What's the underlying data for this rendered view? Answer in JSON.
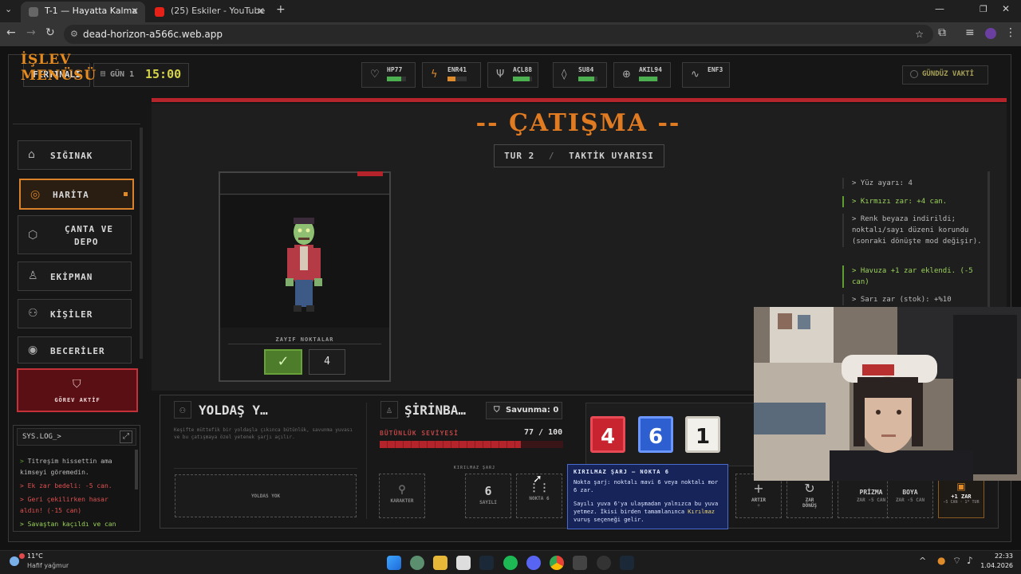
{
  "browser": {
    "tabs": [
      {
        "title": "T-1 — Hayatta Kalma"
      },
      {
        "title": "(25) Eskiler - YouTube"
      }
    ],
    "url": "dead-horizon-a566c.web.app"
  },
  "topbar": {
    "weather": "FIRTINALI",
    "day_label": "GÜN 1",
    "time": "15:00",
    "daytime": "GÜNDÜZ VAKTİ",
    "stats": [
      {
        "label": "HP77",
        "value": 77,
        "color": "#4caf50",
        "icon": "heart-icon"
      },
      {
        "label": "ENR41",
        "value": 41,
        "color": "#e08b2a",
        "icon": "bolt-icon"
      },
      {
        "label": "AÇL88",
        "value": 88,
        "color": "#4caf50",
        "icon": "fork-icon"
      },
      {
        "label": "SU84",
        "value": 84,
        "color": "#4caf50",
        "icon": "drop-icon"
      },
      {
        "label": "AKIL94",
        "value": 94,
        "color": "#4caf50",
        "icon": "brain-icon"
      },
      {
        "label": "ENF3",
        "value": 3,
        "color": "#4caf50",
        "icon": "pulse-icon"
      }
    ]
  },
  "sidebar": {
    "title": "İŞLEV MENÜSÜ",
    "items": [
      {
        "label": "SIĞINAK",
        "icon": "home-icon"
      },
      {
        "label": "HARİTA",
        "icon": "compass-icon"
      },
      {
        "label": "ÇANTA VE",
        "label2": "DEPO",
        "icon": "box-icon"
      },
      {
        "label": "EKİPMAN",
        "icon": "shirt-icon"
      },
      {
        "label": "KİŞİLER",
        "icon": "people-icon"
      },
      {
        "label": "BECERİLER",
        "icon": "target-icon"
      }
    ],
    "mission": "GÖREV AKTİF",
    "syslog_title": "SYS.LOG_>",
    "syslog": [
      {
        "text": "Titreşim hissettin ama kimseyi göremedin.",
        "color": "#bbb"
      },
      {
        "text": "Ek zar bedeli: -5 can.",
        "color": "#e05050"
      },
      {
        "text": "Geri çekilirken hasar aldın! (-15 can)",
        "color": "#e05050"
      },
      {
        "text": "Savaştan kaçıldı ve can",
        "color": "#9ad25a"
      }
    ]
  },
  "combat": {
    "title": "-- ÇATIŞMA --",
    "turn": "TUR 2",
    "turn_sep": "/",
    "warning": "TAKTİK UYARISI",
    "weak_points_label": "ZAYIF NOKTALAR",
    "weak_value": "4"
  },
  "log": [
    {
      "text": "> Yüz ayarı: 4",
      "green": false
    },
    {
      "text": "> Kırmızı zar: +4 can.",
      "green": true
    },
    {
      "text": "> Renk beyaza indirildi; noktalı/sayı düzeni korundu (sonraki dönüşte mod değişir).",
      "green": false
    },
    {
      "text": "> Havuza +1 zar eklendi. (-5 can)",
      "green": true
    },
    {
      "text": "> Sarı zar (stok): +%10",
      "green": false
    }
  ],
  "ally": {
    "title": "YOLDAŞ Y…",
    "desc": "Keşifte müttefik bir yoldaşla çıkınca bütünlük, savunma yuvası ve bu çatışmaya özel yetenek şarjı açılır.",
    "slot": "YOLDAS YOK"
  },
  "player": {
    "name": "ŞİRİNBA…",
    "defense": "Savunma: 0",
    "integrity_label": "BÜTÜNLÜK SEVİYESİ",
    "integrity": "77 / 100",
    "integrity_value": 77,
    "charge_label": "KIRILMAZ ŞARJ",
    "slots": [
      {
        "big": "",
        "label": "KARAKTER"
      },
      {
        "big": "6",
        "label": "SAYILI"
      },
      {
        "big": "⋮⋮",
        "label": "NOKTA 6"
      }
    ]
  },
  "dice": [
    {
      "value": "4",
      "bg": "#c8242f",
      "fg": "#ffffff"
    },
    {
      "value": "6",
      "bg": "#2d5fd0",
      "fg": "#ffffff"
    },
    {
      "value": "1",
      "bg": "#f2f0ea",
      "fg": "#1a1a1a"
    }
  ],
  "tooltip": {
    "title": "KIRILMAZ ŞARJ — NOKTA 6",
    "line1": "Nokta şarj: noktalı mavi 6 veya noktalı mor 6 zar.",
    "line2a": "Sayılı yuva 6'ya ulaşmadan yalnızca bu yuva yetmez. İkisi birden tamamlanınca",
    "line2b": "Kırılmaz",
    "line2c": "vuruş seçeneği gelir."
  },
  "actions": [
    {
      "icon": "+",
      "label": "ARTIR",
      "sub": "+"
    },
    {
      "icon": "↻",
      "label": "ZAR DÖNÜŞ",
      "sub": ""
    },
    {
      "icon": "",
      "label": "PRİZMA",
      "sub": "ZAR -5 CAN"
    },
    {
      "icon": "",
      "label": "BOYA",
      "sub": "ZAR -5 CAN"
    },
    {
      "icon": "▣",
      "label": "+1 ZAR",
      "sub": "-5 CAN · 1* TUR"
    }
  ],
  "taskbar": {
    "temp": "11°C",
    "weather": "Hafif yağmur",
    "time": "22:33",
    "date": "1.04.2026"
  }
}
